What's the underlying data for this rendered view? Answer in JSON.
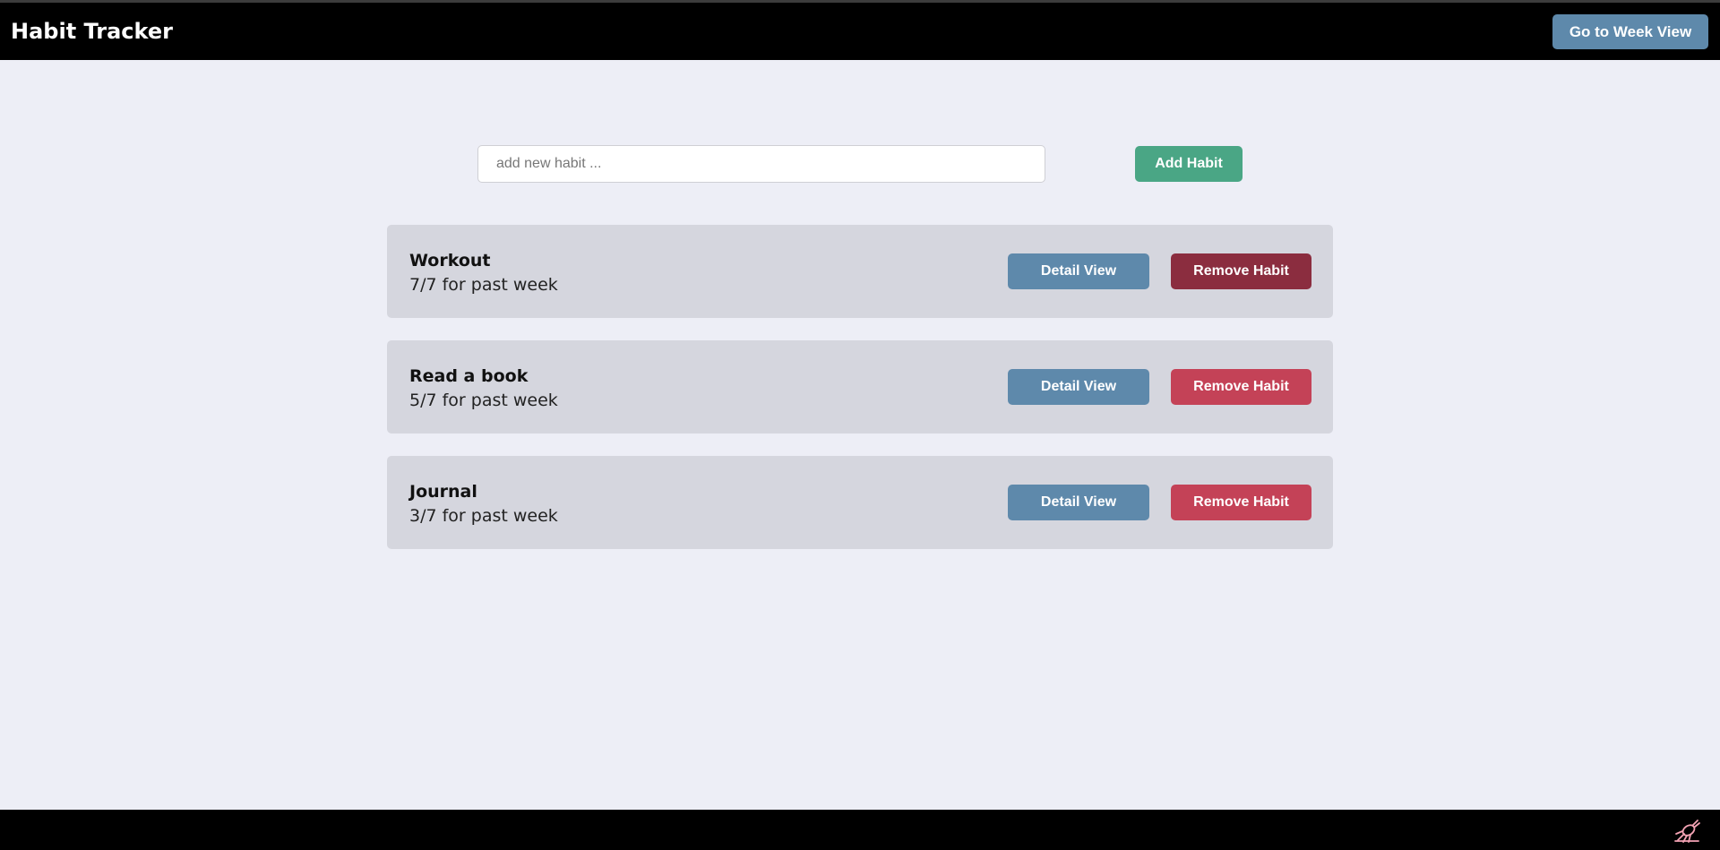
{
  "navbar": {
    "title": "Habit Tracker",
    "week_view_label": "Go to Week View"
  },
  "add_form": {
    "placeholder": "add new habit ...",
    "value": "",
    "add_label": "Add Habit"
  },
  "habits": [
    {
      "name": "Workout",
      "stat": "7/7 for past week",
      "detail_label": "Detail View",
      "remove_label": "Remove Habit",
      "remove_color": "#8b2d3f"
    },
    {
      "name": "Read a book",
      "stat": "5/7 for past week",
      "detail_label": "Detail View",
      "remove_label": "Remove Habit",
      "remove_color": "#c44257"
    },
    {
      "name": "Journal",
      "stat": "3/7 for past week",
      "detail_label": "Detail View",
      "remove_label": "Remove Habit",
      "remove_color": "#c44257"
    }
  ],
  "footer": {
    "icon": "bug-icon"
  },
  "colors": {
    "background": "#edeef6",
    "navbar": "#000000",
    "card": "#d5d6de",
    "primary": "#5e89ab",
    "success": "#4aa685",
    "danger": "#c44257",
    "danger_hover": "#8b2d3f"
  }
}
